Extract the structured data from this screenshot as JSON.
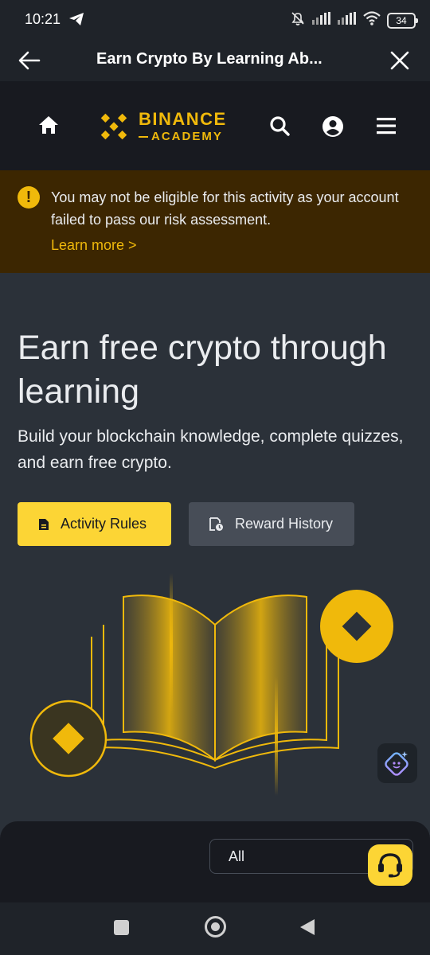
{
  "status_bar": {
    "time": "10:21",
    "battery": "34",
    "icons": [
      "telegram-send-icon",
      "mute-bell-icon",
      "signal-icon",
      "signal-icon",
      "wifi-icon",
      "battery-icon"
    ]
  },
  "title_bar": {
    "title": "Earn Crypto By Learning Ab...",
    "back_icon": "arrow-left-icon",
    "close_icon": "close-icon"
  },
  "header": {
    "logo_line1": "BINANCE",
    "logo_line2": "ACADEMY",
    "icons": [
      "home-icon",
      "search-icon",
      "account-icon",
      "menu-icon"
    ]
  },
  "warning": {
    "text": "You may not be eligible for this activity as your account failed to pass our risk assessment.",
    "link": "Learn more >",
    "icon_glyph": "!"
  },
  "hero": {
    "title": "Earn free crypto through learning",
    "subtitle": "Build your blockchain knowledge, complete quizzes, and earn free crypto.",
    "primary_button": "Activity Rules",
    "secondary_button": "Reward History"
  },
  "filter": {
    "selected": "All"
  },
  "colors": {
    "brand_yellow": "#f0b90b",
    "button_yellow": "#fcd535",
    "background": "#2b3139",
    "header_bg": "#181a20",
    "warning_bg": "#3c2601",
    "secondary_button": "#474d57"
  }
}
